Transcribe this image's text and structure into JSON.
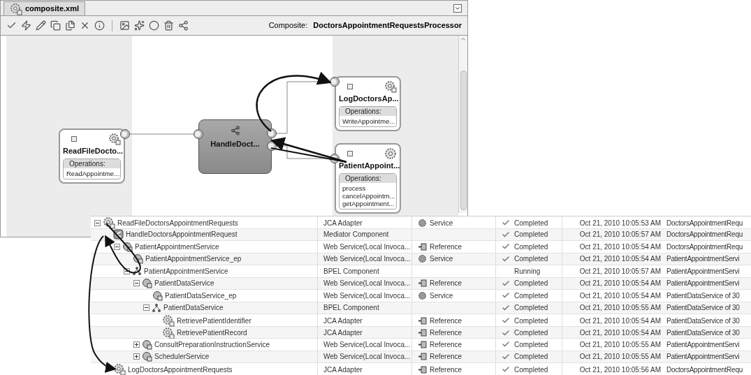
{
  "editor": {
    "tab": "composite.xml",
    "composite_label": "Composite:",
    "composite_name": "DoctorsAppointmentRequestsProcessor",
    "nodes": [
      {
        "kind": "adapter",
        "title": "ReadFileDocto...",
        "operations_label": "Operations:",
        "operations": [
          "ReadAppointme..."
        ]
      },
      {
        "kind": "mediator",
        "title": "HandleDoct..."
      },
      {
        "kind": "adapter",
        "title": "LogDoctorsAp...",
        "operations_label": "Operations:",
        "operations": [
          "WriteAppointme..."
        ]
      },
      {
        "kind": "bpel",
        "title": "PatientAppoint...",
        "operations_label": "Operations:",
        "operations": [
          "process",
          "cancelAppointm...",
          "getAppointment..."
        ]
      }
    ]
  },
  "flow_table": {
    "rows": [
      {
        "name": "ReadFileDoctorsAppointmentRequests",
        "kind": "adapter",
        "expanded": true,
        "type": "JCA Adapter",
        "role": "Service",
        "inbound": true,
        "status": "Completed",
        "done": true,
        "time": "Oct 21, 2010 10:05:53 AM",
        "instance": "DoctorsAppointmentRequ",
        "children": [
          {
            "name": "HandleDoctorsAppointmentRequest",
            "kind": "mediator",
            "type": "Mediator Component",
            "status": "Completed",
            "done": true,
            "time": "Oct 21, 2010 10:05:57 AM",
            "instance": "DoctorsAppointmentRequ",
            "children": [
              {
                "name": "PatientAppointmentService",
                "kind": "webservice",
                "expanded": true,
                "type": "Web Service(Local Invoca...",
                "role": "Reference",
                "inbound": false,
                "status": "Completed",
                "done": true,
                "time": "Oct 21, 2010 10:05:54 AM",
                "instance": "DoctorsAppointmentRequ",
                "children": [
                  {
                    "name": "PatientAppointmentService_ep",
                    "kind": "webservice",
                    "type": "Web Service(Local Invoca...",
                    "role": "Service",
                    "inbound": true,
                    "status": "Completed",
                    "done": true,
                    "time": "Oct 21, 2010 10:05:54 AM",
                    "instance": "PatientAppointmentServi"
                  },
                  {
                    "name": "PatientAppointmentService",
                    "kind": "bpel",
                    "expanded": true,
                    "type": "BPEL Component",
                    "status": "Running",
                    "done": false,
                    "time": "Oct 21, 2010 10:05:57 AM",
                    "instance": "PatientAppointmentServi",
                    "children": [
                      {
                        "name": "PatientDataService",
                        "kind": "webservice",
                        "expanded": true,
                        "type": "Web Service(Local Invoca...",
                        "role": "Reference",
                        "inbound": false,
                        "status": "Completed",
                        "done": true,
                        "time": "Oct 21, 2010 10:05:54 AM",
                        "instance": "PatientAppointmentServi",
                        "children": [
                          {
                            "name": "PatientDataService_ep",
                            "kind": "webservice",
                            "type": "Web Service(Local Invoca...",
                            "role": "Service",
                            "inbound": true,
                            "status": "Completed",
                            "done": true,
                            "time": "Oct 21, 2010 10:05:54 AM",
                            "instance": "PatientDataService of 30"
                          },
                          {
                            "name": "PatientDataService",
                            "kind": "bpel",
                            "expanded": true,
                            "type": "BPEL Component",
                            "status": "Completed",
                            "done": true,
                            "time": "Oct 21, 2010 10:05:55 AM",
                            "instance": "PatientDataService of 30",
                            "children": [
                              {
                                "name": "RetrievePatientIdentifier",
                                "kind": "adapter",
                                "type": "JCA Adapter",
                                "role": "Reference",
                                "inbound": false,
                                "status": "Completed",
                                "done": true,
                                "time": "Oct 21, 2010 10:05:54 AM",
                                "instance": "PatientDataService of 30"
                              },
                              {
                                "name": "RetrievePatientRecord",
                                "kind": "adapter",
                                "type": "JCA Adapter",
                                "role": "Reference",
                                "inbound": false,
                                "status": "Completed",
                                "done": true,
                                "time": "Oct 21, 2010 10:05:54 AM",
                                "instance": "PatientDataService of 30"
                              }
                            ]
                          }
                        ]
                      },
                      {
                        "name": "ConsultPreparationInstructionService",
                        "kind": "webservice",
                        "expanded": false,
                        "type": "Web Service(Local Invoca...",
                        "role": "Reference",
                        "inbound": false,
                        "status": "Completed",
                        "done": true,
                        "time": "Oct 21, 2010 10:05:55 AM",
                        "instance": "PatientAppointmentServi"
                      },
                      {
                        "name": "SchedulerService",
                        "kind": "webservice",
                        "expanded": false,
                        "type": "Web Service(Local Invoca...",
                        "role": "Reference",
                        "inbound": false,
                        "status": "Completed",
                        "done": true,
                        "time": "Oct 21, 2010 10:05:55 AM",
                        "instance": "PatientAppointmentServi"
                      }
                    ]
                  }
                ]
              }
            ]
          },
          {
            "name": "LogDoctorsAppointmentRequests",
            "kind": "adapter",
            "type": "JCA Adapter",
            "role": "Reference",
            "inbound": false,
            "status": "Completed",
            "done": true,
            "time": "Oct 21, 2010 10:05:56 AM",
            "instance": "DoctorsAppointmentRequ"
          }
        ]
      }
    ]
  }
}
